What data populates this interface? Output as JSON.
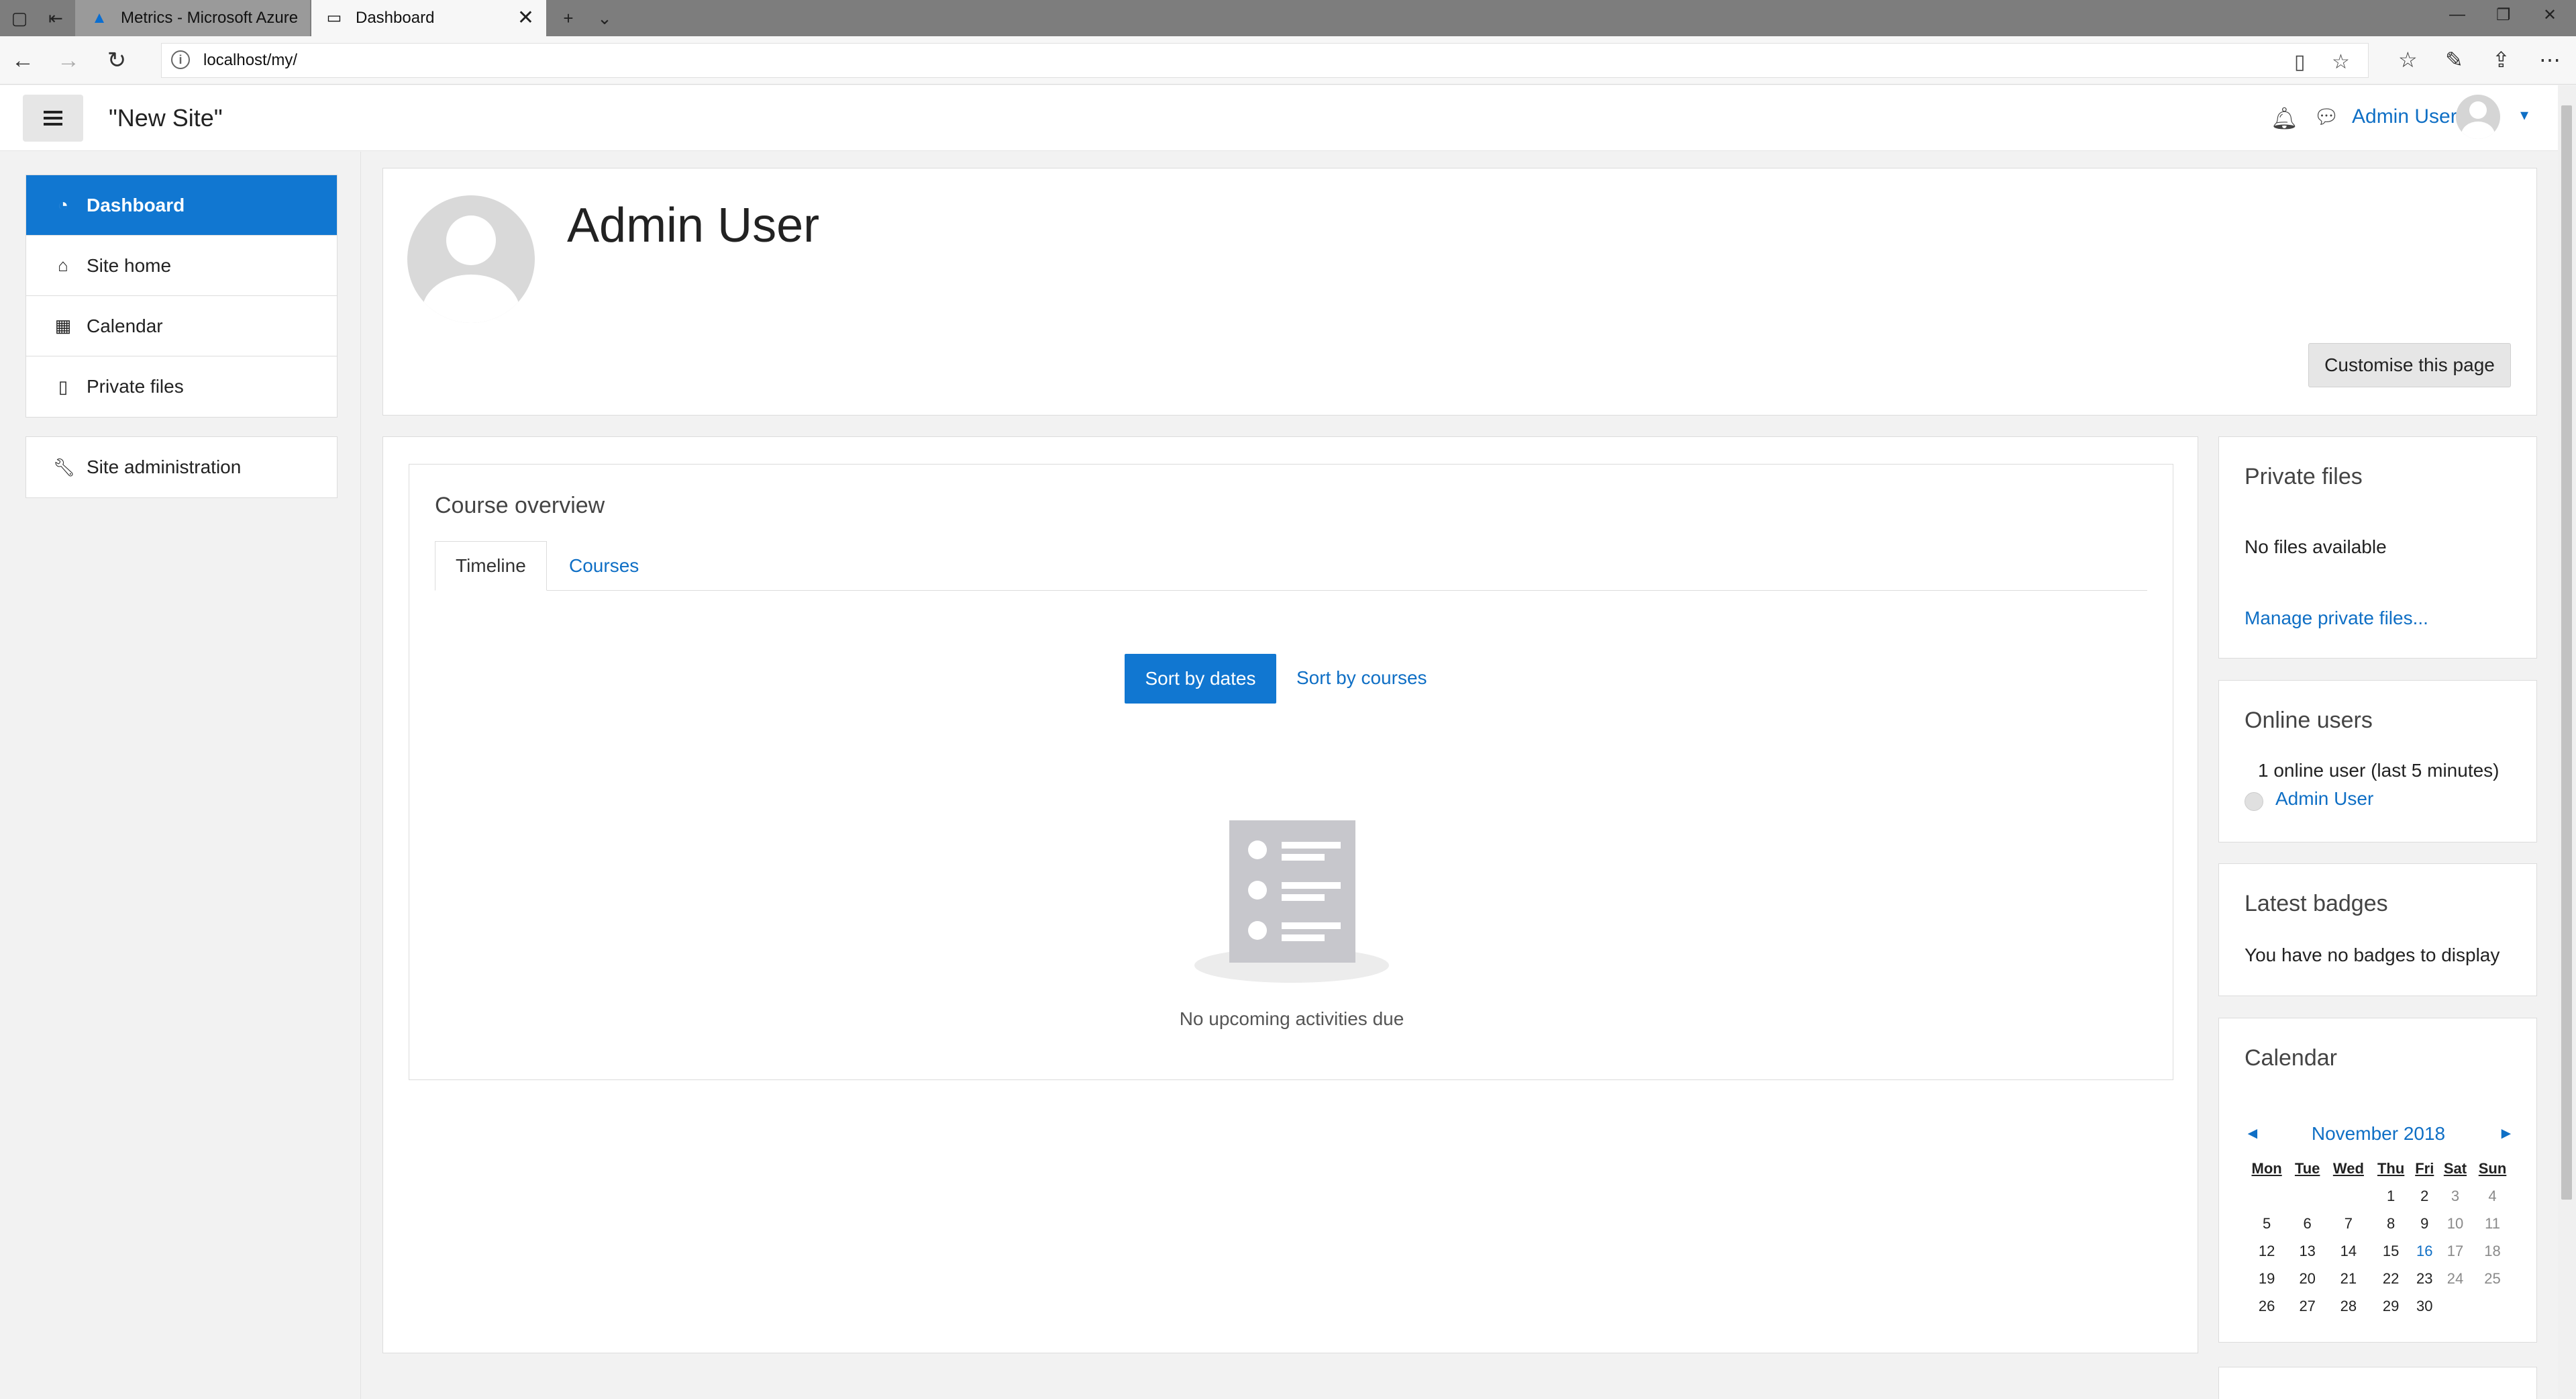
{
  "browser": {
    "tabs": [
      {
        "title": "Metrics - Microsoft Azure",
        "active": false
      },
      {
        "title": "Dashboard",
        "active": true
      }
    ],
    "url": "localhost/my/"
  },
  "header": {
    "site_name": "\"New Site\"",
    "user_name": "Admin User"
  },
  "nav": {
    "items": [
      {
        "label": "Dashboard",
        "icon": "dashboard-icon",
        "active": true
      },
      {
        "label": "Site home",
        "icon": "home-icon"
      },
      {
        "label": "Calendar",
        "icon": "calendar-icon"
      },
      {
        "label": "Private files",
        "icon": "file-icon"
      }
    ],
    "admin": {
      "label": "Site administration",
      "icon": "wrench-icon"
    }
  },
  "page_header": {
    "title": "Admin User",
    "customise_label": "Customise this page"
  },
  "course_overview": {
    "title": "Course overview",
    "tabs": [
      "Timeline",
      "Courses"
    ],
    "sort_dates_label": "Sort by dates",
    "sort_courses_label": "Sort by courses",
    "empty_text": "No upcoming activities due"
  },
  "private_files": {
    "title": "Private files",
    "empty_text": "No files available",
    "manage_link": "Manage private files..."
  },
  "online_users": {
    "title": "Online users",
    "summary": "1 online user (last 5 minutes)",
    "user": "Admin User"
  },
  "latest_badges": {
    "title": "Latest badges",
    "empty_text": "You have no badges to display"
  },
  "calendar": {
    "title": "Calendar",
    "month": "November 2018",
    "prev": "◄",
    "next": "►",
    "days": [
      "Mon",
      "Tue",
      "Wed",
      "Thu",
      "Fri",
      "Sat",
      "Sun"
    ],
    "weeks": [
      [
        "",
        "",
        "",
        "1",
        "2",
        "3",
        "4"
      ],
      [
        "5",
        "6",
        "7",
        "8",
        "9",
        "10",
        "11"
      ],
      [
        "12",
        "13",
        "14",
        "15",
        "16",
        "17",
        "18"
      ],
      [
        "19",
        "20",
        "21",
        "22",
        "23",
        "24",
        "25"
      ],
      [
        "26",
        "27",
        "28",
        "29",
        "30",
        "",
        ""
      ]
    ],
    "today": "16"
  }
}
